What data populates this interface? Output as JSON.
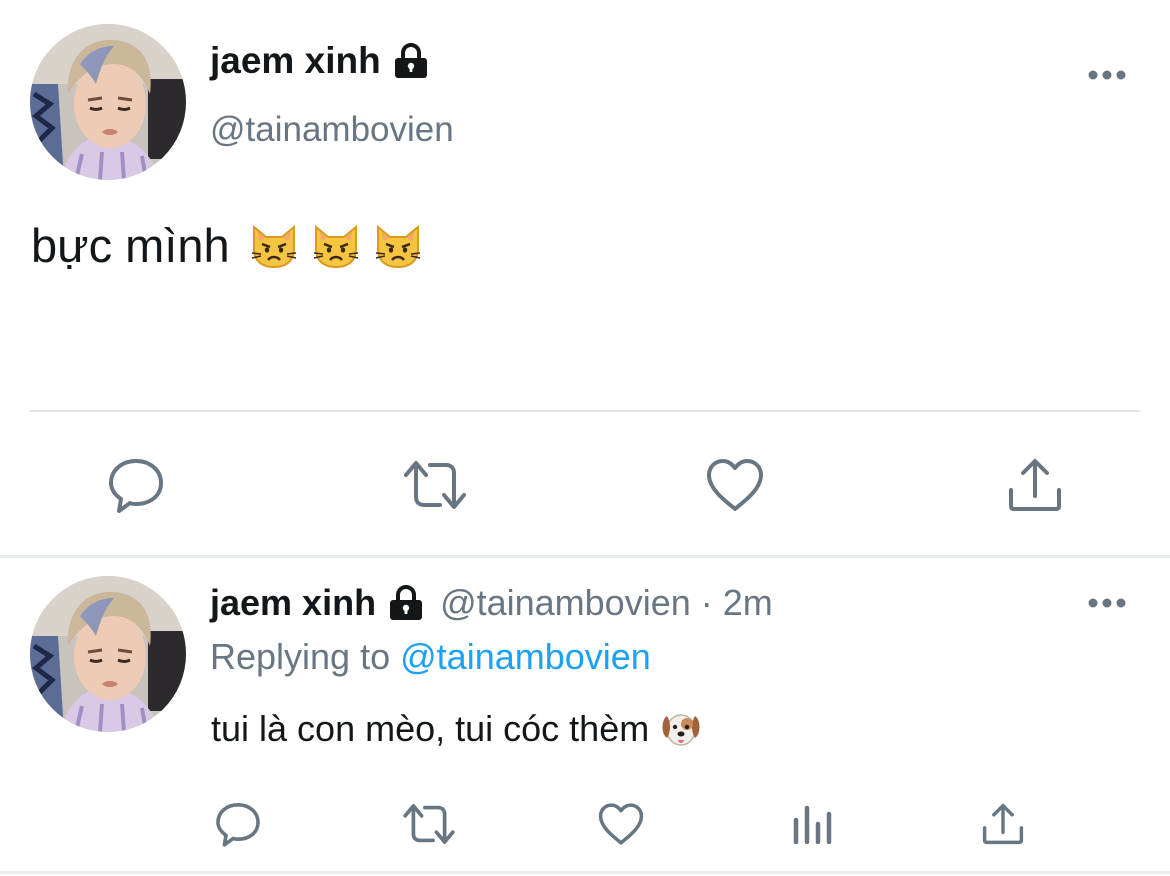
{
  "main_tweet": {
    "display_name": "jaem xinh",
    "handle": "@tainambovien",
    "protected": true,
    "text": "bực mình",
    "emojis": [
      "pouting-cat",
      "pouting-cat",
      "pouting-cat"
    ],
    "actions": [
      "reply",
      "retweet",
      "like",
      "share"
    ]
  },
  "reply_tweet": {
    "display_name": "jaem xinh",
    "handle": "@tainambovien",
    "separator": "·",
    "time": "2m",
    "protected": true,
    "replying_prefix": "Replying to",
    "replying_to": "@tainambovien",
    "text": "tui là con mèo, tui cóc thèm",
    "emoji": "dog-face",
    "actions": [
      "reply",
      "retweet",
      "like",
      "analytics",
      "share"
    ]
  },
  "colors": {
    "text": "#14171a",
    "secondary": "#687684",
    "link": "#1da1f2",
    "divider": "#e3e7ea",
    "icon": "#687684"
  }
}
